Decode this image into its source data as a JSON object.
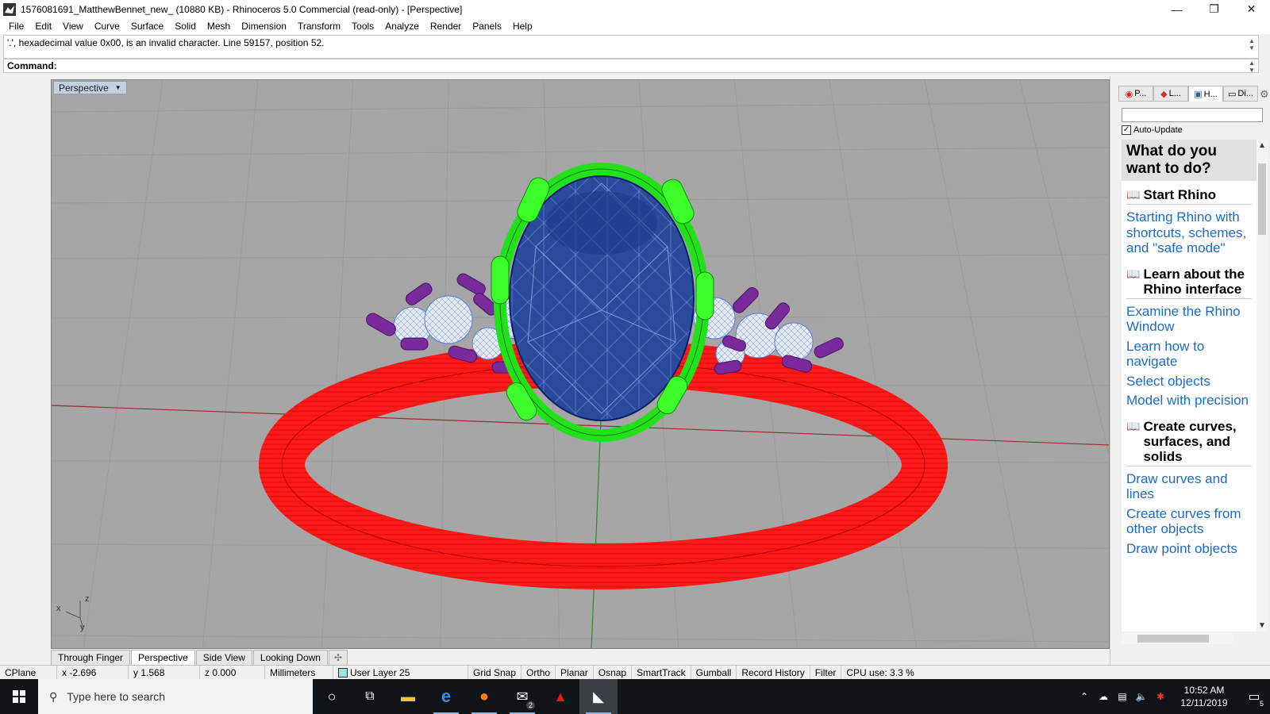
{
  "window": {
    "title": "1576081691_MatthewBennet_new_ (10880 KB) - Rhinoceros 5.0 Commercial (read-only) - [Perspective]",
    "minimize_glyph": "—",
    "maximize_glyph": "❐",
    "close_glyph": "✕"
  },
  "menu": [
    "File",
    "Edit",
    "View",
    "Curve",
    "Surface",
    "Solid",
    "Mesh",
    "Dimension",
    "Transform",
    "Tools",
    "Analyze",
    "Render",
    "Panels",
    "Help"
  ],
  "command": {
    "history": "'.', hexadecimal value 0x00, is an invalid character. Line 59157, position 52.",
    "prompt": "Command:"
  },
  "viewport": {
    "label": "Perspective",
    "axis_x": "x",
    "axis_y": "y",
    "axis_z": "z",
    "tabs": [
      {
        "label": "Through Finger",
        "active": false
      },
      {
        "label": "Perspective",
        "active": true
      },
      {
        "label": "Side View",
        "active": false
      },
      {
        "label": "Looking Down",
        "active": false
      }
    ],
    "add_tab_glyph": "✣"
  },
  "panel": {
    "tabs": [
      {
        "icon": "properties-icon",
        "label": "P..."
      },
      {
        "icon": "layers-icon",
        "label": "L..."
      },
      {
        "icon": "help-icon",
        "label": "H..."
      },
      {
        "icon": "display-icon",
        "label": "Di..."
      }
    ],
    "auto_update": "Auto-Update",
    "help": {
      "question": "What do you want to do?",
      "sections": [
        {
          "head": "Start Rhino",
          "links": [
            "Starting Rhino with shortcuts, schemes, and \"safe mode\""
          ]
        },
        {
          "head": "Learn about the Rhino interface",
          "links": [
            "Examine the Rhino Window",
            "Learn how to navigate",
            "Select objects",
            "Model with precision"
          ]
        },
        {
          "head": "Create curves, surfaces, and solids",
          "links": [
            "Draw curves and lines",
            "Create curves from other objects",
            "Draw point objects"
          ]
        }
      ]
    }
  },
  "status": {
    "cplane": "CPlane",
    "x": "x -2.696",
    "y": "y 1.568",
    "z": "z 0.000",
    "units": "Millimeters",
    "layer": "User Layer 25",
    "layer_color": "#9fe0e0",
    "toggles": [
      "Grid Snap",
      "Ortho",
      "Planar",
      "Osnap",
      "SmartTrack",
      "Gumball",
      "Record History",
      "Filter"
    ],
    "cpu": "CPU use: 3.3 %"
  },
  "taskbar": {
    "search_placeholder": "Type here to search",
    "mail_badge": "2",
    "time": "10:52 AM",
    "date": "12/11/2019",
    "notification_count": "5"
  },
  "colors": {
    "band": "#ff1a1a",
    "bezel": "#22e01a",
    "stone": "#2c4a9c",
    "side_stone": "#dfe8ff",
    "prong": "#7a2a9a",
    "viewport_bg": "#a6a6a6"
  }
}
